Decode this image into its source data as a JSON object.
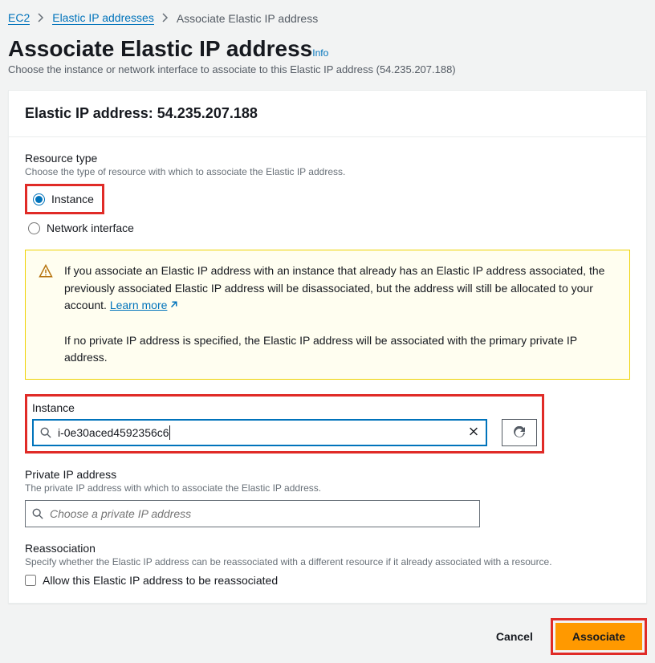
{
  "breadcrumb": {
    "ec2": "EC2",
    "eip": "Elastic IP addresses",
    "current": "Associate Elastic IP address"
  },
  "page": {
    "title": "Associate Elastic IP address",
    "info": "Info",
    "subtitle": "Choose the instance or network interface to associate to this Elastic IP address (54.235.207.188)"
  },
  "panel": {
    "heading": "Elastic IP address: 54.235.207.188"
  },
  "resourceType": {
    "label": "Resource type",
    "desc": "Choose the type of resource with which to associate the Elastic IP address.",
    "option1": "Instance",
    "option2": "Network interface"
  },
  "alert": {
    "line1": "If you associate an Elastic IP address with an instance that already has an Elastic IP address associated, the previously associated Elastic IP address will be disassociated, but the address will still be allocated to your account. ",
    "learn": "Learn more",
    "line2": "If no private IP address is specified, the Elastic IP address will be associated with the primary private IP address."
  },
  "instance": {
    "label": "Instance",
    "value": "i-0e30aced4592356c6"
  },
  "privateIP": {
    "label": "Private IP address",
    "desc": "The private IP address with which to associate the Elastic IP address.",
    "placeholder": "Choose a private IP address"
  },
  "reassociation": {
    "label": "Reassociation",
    "desc": "Specify whether the Elastic IP address can be reassociated with a different resource if it already associated with a resource.",
    "checkbox": "Allow this Elastic IP address to be reassociated"
  },
  "footer": {
    "cancel": "Cancel",
    "associate": "Associate"
  }
}
